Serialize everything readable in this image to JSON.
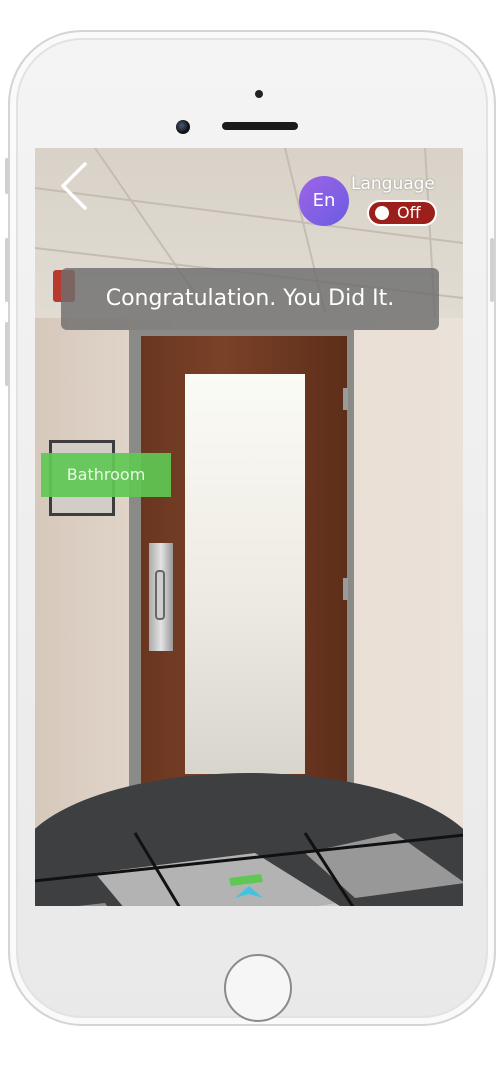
{
  "header": {
    "back_icon": "chevron-left-icon",
    "language_code": "En",
    "language_label": "Language",
    "language_toggle_state": "Off"
  },
  "banner": {
    "text": "Congratulation. You Did It."
  },
  "ar_labels": {
    "destination": "Bathroom"
  },
  "colors": {
    "avatar_gradient_start": "#9f63e6",
    "avatar_gradient_end": "#6a5de2",
    "toggle_off": "#9b1f1a",
    "destination_label": "#5fc854",
    "banner": "#6e6e6e",
    "arrow": "#43c3e0"
  }
}
